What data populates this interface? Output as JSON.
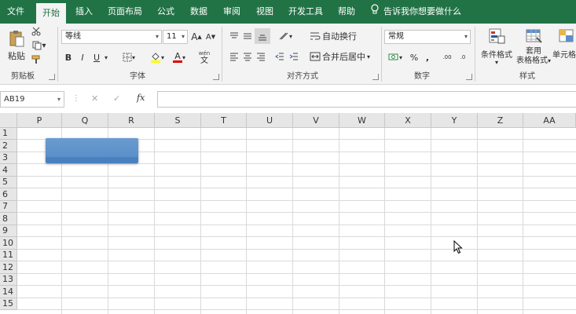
{
  "ribbon_tabs": [
    {
      "label": "文件",
      "active": false
    },
    {
      "label": "开始",
      "active": true
    },
    {
      "label": "插入",
      "active": false
    },
    {
      "label": "页面布局",
      "active": false
    },
    {
      "label": "公式",
      "active": false
    },
    {
      "label": "数据",
      "active": false
    },
    {
      "label": "审阅",
      "active": false
    },
    {
      "label": "视图",
      "active": false
    },
    {
      "label": "开发工具",
      "active": false
    },
    {
      "label": "帮助",
      "active": false
    }
  ],
  "tell_me": "告诉我你想要做什么",
  "clipboard": {
    "paste_label": "粘贴",
    "group_label": "剪贴板"
  },
  "font": {
    "name": "等线",
    "size": "11",
    "group_label": "字体",
    "bold": "B",
    "italic": "I",
    "underline": "U",
    "grow": "A",
    "shrink": "A",
    "color_letter": "A",
    "wen": "wén",
    "wen_char": "文"
  },
  "alignment": {
    "wrap_label": "自动换行",
    "merge_label": "合并后居中",
    "group_label": "对齐方式"
  },
  "number": {
    "format": "常规",
    "group_label": "数字",
    "percent": "%",
    "comma": ",",
    "inc_decimal": ".00",
    "dec_decimal": ".0"
  },
  "styles": {
    "conditional_label": "条件格式",
    "table_label_1": "套用",
    "table_label_2": "表格格式",
    "cell_styles_label": "单元格",
    "group_label": "样式"
  },
  "formula_bar": {
    "name_box": "AB19",
    "cancel": "✕",
    "enter": "✓",
    "fx": "fx",
    "value": ""
  },
  "columns": [
    "P",
    "Q",
    "R",
    "S",
    "T",
    "U",
    "V",
    "W",
    "X",
    "Y",
    "Z",
    "AA"
  ],
  "rows": [
    "1",
    "2",
    "3",
    "4",
    "5",
    "6",
    "7",
    "8",
    "9",
    "10",
    "11",
    "12",
    "13",
    "14",
    "15"
  ],
  "colors": {
    "accent": "#217346",
    "shape_fill": "#5b8fc8",
    "ribbon_bg": "#f3f3f3"
  }
}
